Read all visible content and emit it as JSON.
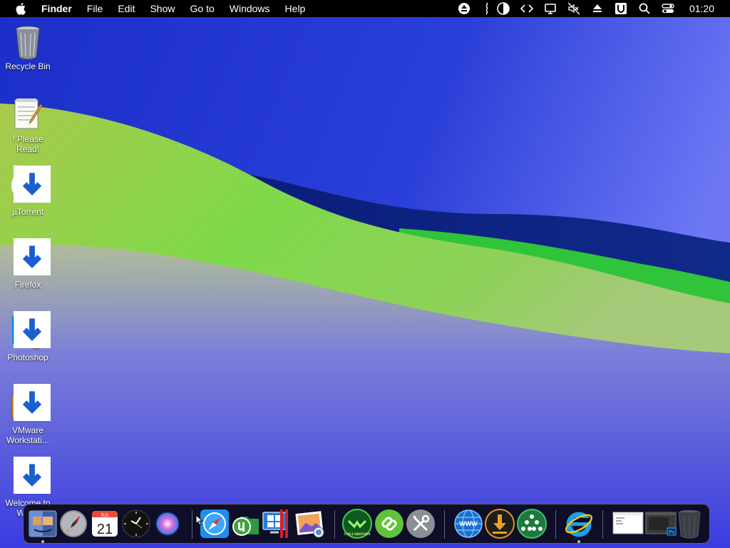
{
  "menubar": {
    "apple_icon": "apple-logo-icon",
    "items": [
      "Finder",
      "File",
      "Edit",
      "Show",
      "Go to",
      "Windows",
      "Help"
    ],
    "status_icons": [
      "eject-icon",
      "pen-icon",
      "contrast-icon",
      "code-icon",
      "display-icon",
      "mute-icon",
      "upload-icon",
      "u-badge-icon",
      "search-icon",
      "control-center-icon"
    ],
    "clock": "01:20"
  },
  "desktop": {
    "icons": [
      {
        "name": "recycle-bin",
        "label": "Recycle Bin"
      },
      {
        "name": "please-read",
        "label": "! Please Read!"
      },
      {
        "name": "utorrent",
        "label": "µTorrent"
      },
      {
        "name": "firefox",
        "label": "Firefox"
      },
      {
        "name": "photoshop",
        "label": "Photoshop"
      },
      {
        "name": "vmware",
        "label": "VMware Workstati..."
      },
      {
        "name": "welcome",
        "label": "Welcome to Win..."
      }
    ]
  },
  "dock": {
    "calendar_month": "JUL",
    "calendar_day": "21",
    "collabsysos_label": "COLLABSYSOS",
    "www_label": "WWW",
    "items": [
      "finder-icon",
      "launchpad-icon",
      "calendar-icon",
      "clock-icon",
      "siri-icon",
      "safari-icon",
      "utorrent-folder-icon",
      "windows-app-icon",
      "photo-viewer-icon",
      "collabsysos-icon",
      "link-icon",
      "tools-icon",
      "www-globe-icon",
      "download-icon",
      "network-icon",
      "internet-explorer-icon",
      "notepad-window-icon",
      "photoshop-window-icon",
      "trash-icon"
    ]
  }
}
